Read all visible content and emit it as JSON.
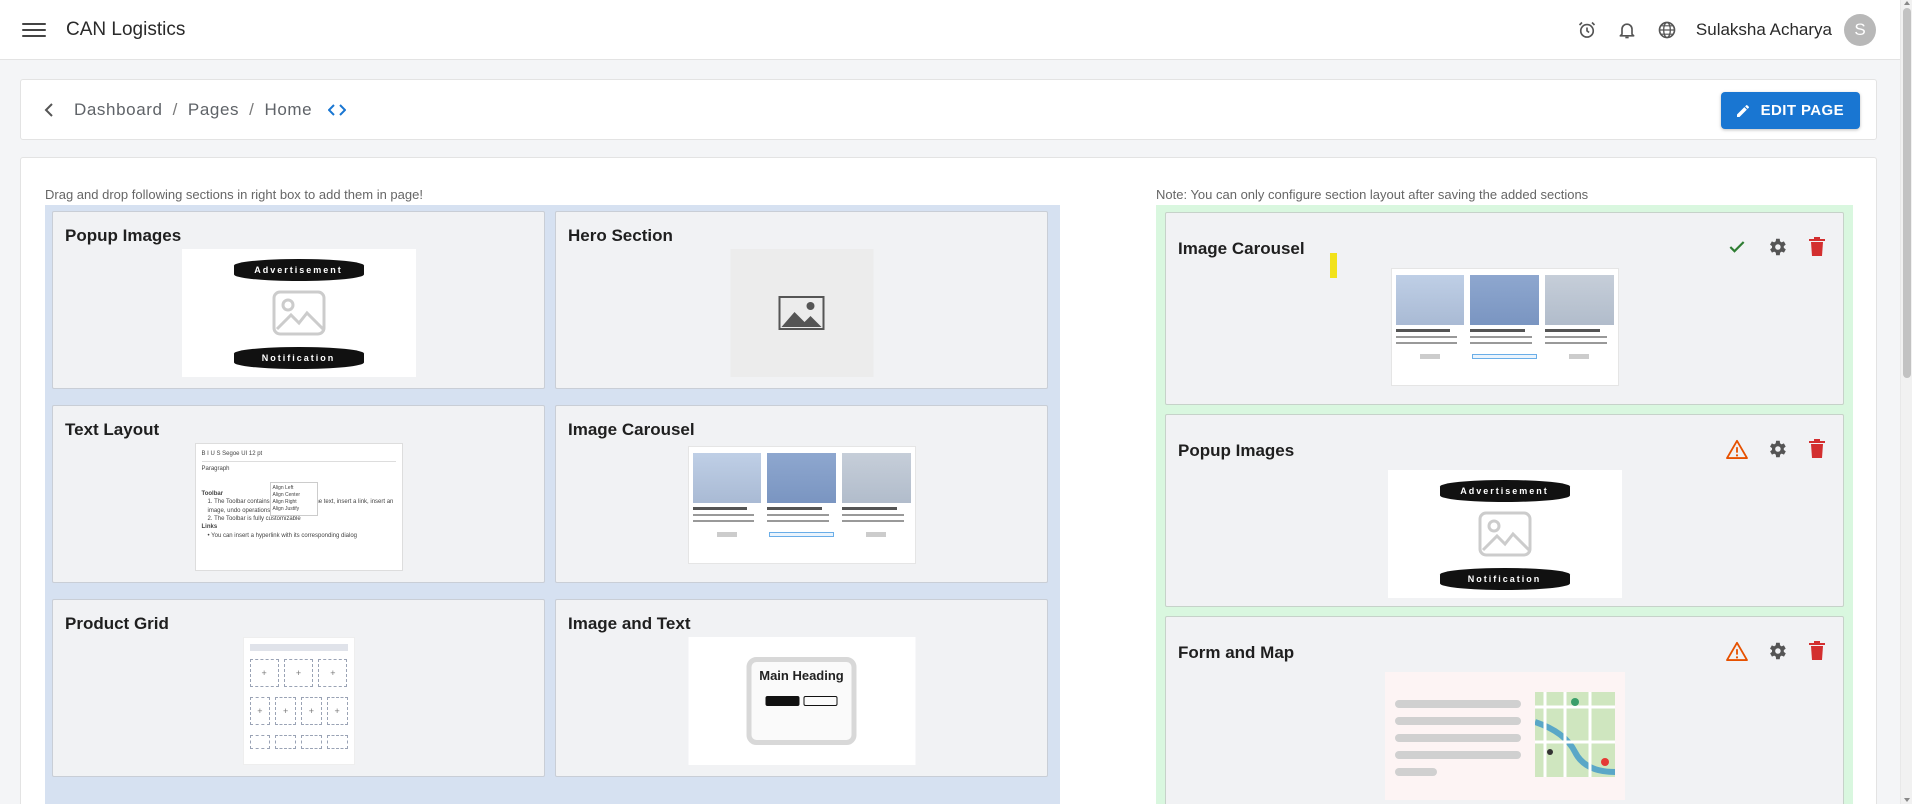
{
  "header": {
    "brand": "CAN Logistics",
    "user_name": "Sulaksha Acharya",
    "avatar_initial": "S",
    "icons": [
      "menu-icon",
      "alarm-clock-icon",
      "bell-icon",
      "globe-icon"
    ]
  },
  "breadcrumb": {
    "items": [
      "Dashboard",
      "Pages",
      "Home"
    ],
    "separator": "/",
    "edit_label": "EDIT PAGE"
  },
  "hints": {
    "left": "Drag and drop following sections in right box to add them in page!",
    "right": "Note: You can only configure section layout after saving the added sections"
  },
  "available_sections": [
    {
      "title": "Popup Images"
    },
    {
      "title": "Hero Section"
    },
    {
      "title": "Text Layout"
    },
    {
      "title": "Image Carousel"
    },
    {
      "title": "Product Grid"
    },
    {
      "title": "Image and Text"
    }
  ],
  "added_sections": [
    {
      "title": "Image Carousel",
      "status": "check-icon",
      "status_color": "#2e7d32"
    },
    {
      "title": "Popup Images",
      "status": "warning-icon",
      "status_color": "#e65100"
    },
    {
      "title": "Form and Map",
      "status": "warning-icon",
      "status_color": "#e65100"
    }
  ],
  "previews": {
    "banner_top": "Advertisement",
    "banner_bottom": "Notification",
    "image_text_heading": "Main Heading",
    "editor_toolbar": "B  I  U  S   Segoe UI   12 pt",
    "editor_paragraph": "Paragraph",
    "editor_menu": [
      "Align Left",
      "Align Center",
      "Align Right",
      "Align Justify"
    ],
    "editor_heading_1": "Toolbar",
    "editor_list_1": "1. The Toolbar contains buttons to align the text, insert a link, insert an image, undo operations, HTML view, etc",
    "editor_list_2": "2. The Toolbar is fully customizable",
    "editor_heading_2": "Links",
    "editor_list_3": "• You can insert a hyperlink with its corresponding dialog"
  },
  "colors": {
    "accent": "#1976d2",
    "left_panel_bg": "#d6e1f1",
    "right_panel_bg": "#d9f7df",
    "delete": "#d32f2f"
  }
}
